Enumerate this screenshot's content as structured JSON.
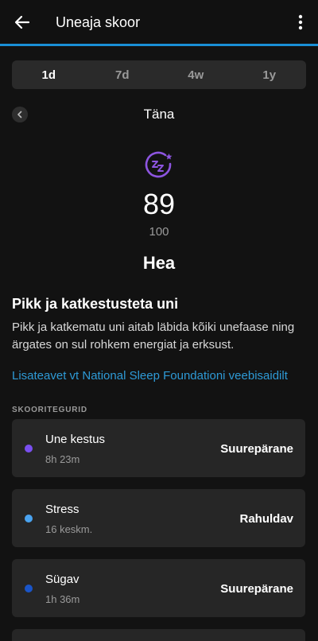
{
  "header": {
    "title": "Uneaja skoor"
  },
  "tabs": [
    {
      "label": "1d",
      "active": true
    },
    {
      "label": "7d",
      "active": false
    },
    {
      "label": "4w",
      "active": false
    },
    {
      "label": "1y",
      "active": false
    }
  ],
  "date_label": "Täna",
  "score": {
    "value": "89",
    "max": "100",
    "rating": "Hea"
  },
  "info": {
    "heading": "Pikk ja katkestusteta uni",
    "description": "Pikk ja katkematu uni aitab läbida kõiki unefaase ning ärgates on sul rohkem energiat ja erksust.",
    "link": "Lisateavet vt National Sleep Foundationi veebisaidilt"
  },
  "section_title": "SKOORITEGURID",
  "factors": [
    {
      "name": "Une kestus",
      "sub": "8h 23m",
      "value": "Suurepärane",
      "color": "#7a4ff0"
    },
    {
      "name": "Stress",
      "sub": "16 keskm.",
      "value": "Rahuldav",
      "color": "#4aa3f0"
    },
    {
      "name": "Sügav",
      "sub": "1h 36m",
      "value": "Suurepärane",
      "color": "#1a55c8"
    }
  ],
  "colors": {
    "accent": "#1a8fd6",
    "sleep_icon": "#8d55e0"
  },
  "icons": {
    "back": "arrow-left-icon",
    "more": "more-vert-icon",
    "prev": "chevron-left-icon",
    "sleep": "sleep-zz-icon"
  }
}
